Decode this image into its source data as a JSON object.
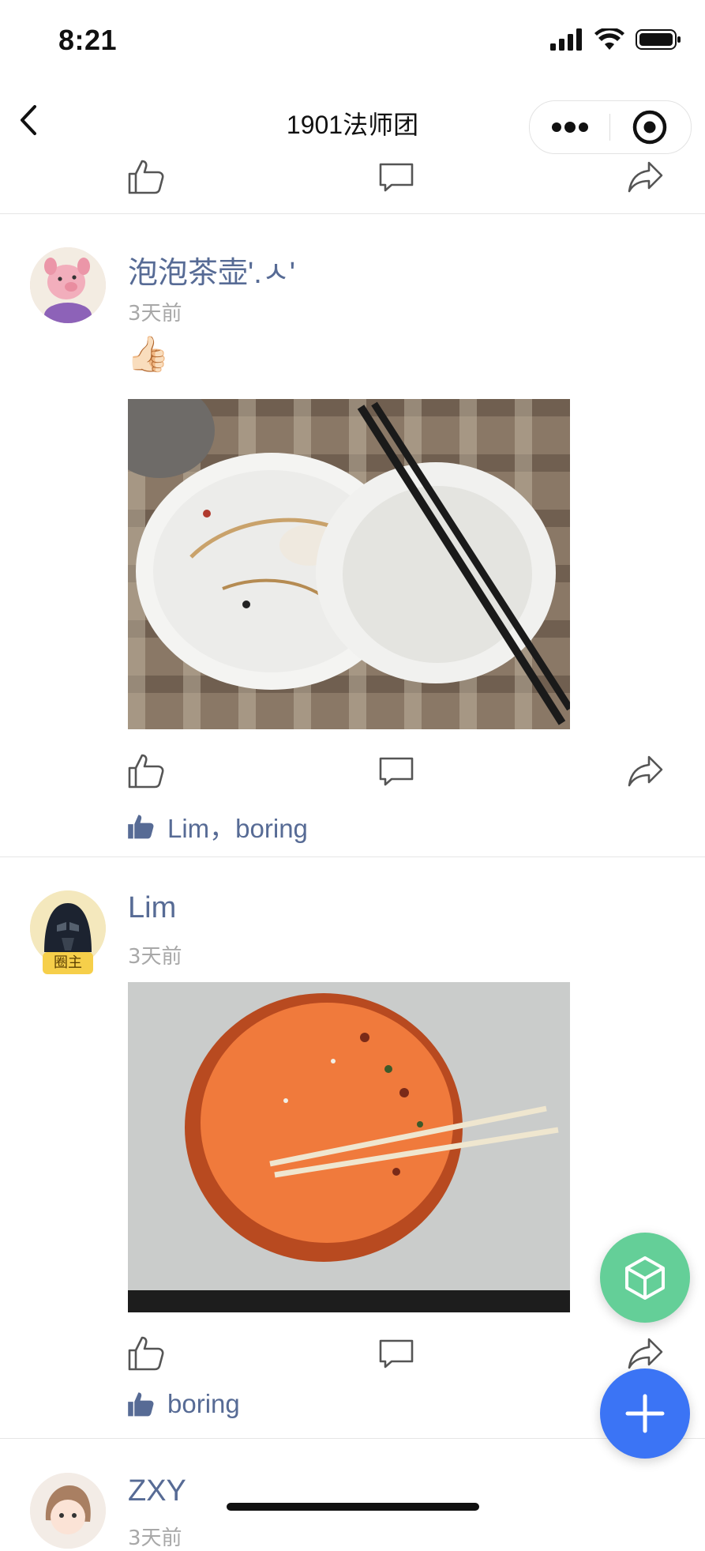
{
  "status_bar": {
    "time": "8:21"
  },
  "nav": {
    "title": "1901法师团"
  },
  "posts": [
    {
      "username": "泡泡茶壶'.ㅅ'",
      "time": "3天前",
      "text": "👍🏻",
      "image_desc": "empty-plates-photo",
      "likes": "Lim，boring"
    },
    {
      "username": "Lim",
      "badge": "圈主",
      "time": "3天前",
      "image_desc": "orange-plate-photo",
      "likes": "boring"
    },
    {
      "username": "ZXY",
      "time": "3天前"
    }
  ],
  "colors": {
    "link": "#576b95",
    "fab_green": "#64cf98",
    "fab_blue": "#3b74f5"
  }
}
